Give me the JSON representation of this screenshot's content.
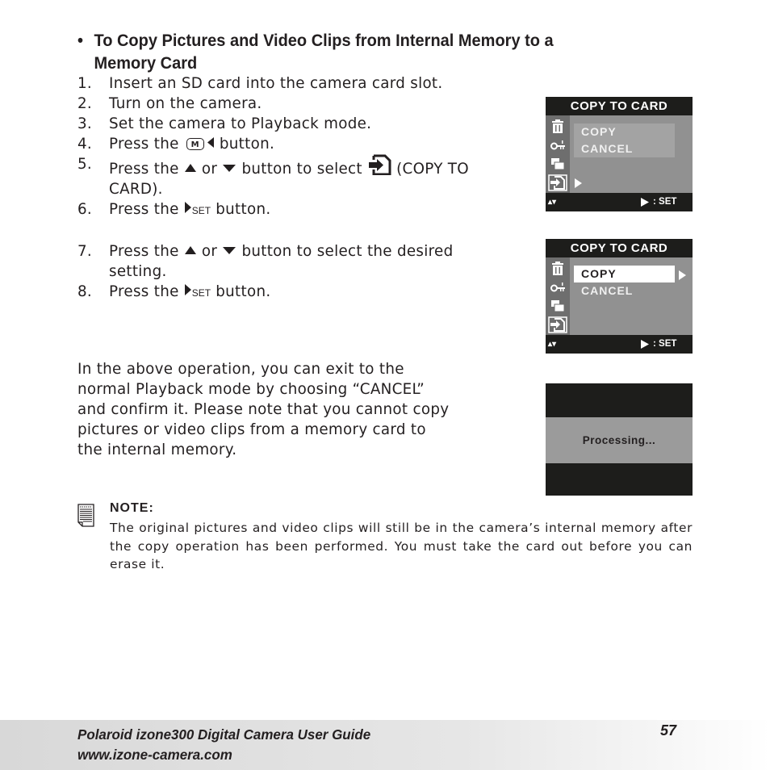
{
  "heading": {
    "bullet": "•",
    "line1": "To Copy Pictures and Video Clips from Internal Memory to a",
    "line2": "Memory Card"
  },
  "steps": [
    {
      "num": "1.",
      "text": "Insert an SD card into the camera card slot."
    },
    {
      "num": "2.",
      "text": "Turn on the camera."
    },
    {
      "num": "3.",
      "text": "Set the camera to Playback mode."
    },
    {
      "num": "4.",
      "pre": "Press the",
      "icon_m": "M",
      "post": "button."
    },
    {
      "num": "5.",
      "pre": "Press the",
      "or": "or",
      "mid": "button to select",
      "post": "(COPY TO",
      "cont": "CARD)."
    },
    {
      "num": "6.",
      "pre": "Press the",
      "set": "SET",
      "post": "button."
    },
    {
      "num": "7.",
      "pre": "Press the",
      "or": "or",
      "post": "button to select the desired",
      "cont": "setting."
    },
    {
      "num": "8.",
      "pre": "Press the",
      "set": "SET",
      "post": "button."
    }
  ],
  "paragraph": [
    "In the above operation, you can exit to the",
    "normal Playback mode by choosing “CANCEL”",
    "and confirm it. Please note that you cannot copy",
    "pictures or video clips from a memory card to",
    "the internal memory."
  ],
  "screens": [
    {
      "title": "COPY TO CARD",
      "items": [
        "COPY",
        "CANCEL"
      ],
      "selected": null,
      "footer_left": "▴▾",
      "footer_right": ":  SET"
    },
    {
      "title": "COPY TO CARD",
      "items": [
        "COPY",
        "CANCEL"
      ],
      "selected": "COPY",
      "footer_left": "▴▾",
      "footer_right": ":  SET"
    }
  ],
  "processing": {
    "text": "Processing..."
  },
  "note": {
    "title": "NOTE:",
    "text": "The original pictures and video clips will still be in the camera’s internal memory after the copy operation has been performed. You must take the card out before you can erase it."
  },
  "footer": {
    "title": "Polaroid izone300 Digital Camera User Guide",
    "url": "www.izone-camera.com",
    "page": "57"
  },
  "colors": {
    "screen_dark": "#1d1d1b",
    "screen_gray": "#919191",
    "footer_gray": "#d8d8d8"
  }
}
